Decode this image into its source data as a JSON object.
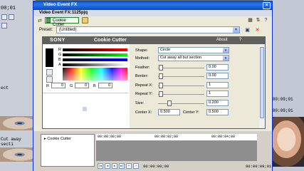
{
  "window": {
    "title": "Video Event FX"
  },
  "header": {
    "label": "Video Event FX:",
    "event_name": "1125pjq"
  },
  "chain": {
    "plugin_label": "Cookie Cutter"
  },
  "preset": {
    "label": "Preset:",
    "value": "(Untitled)"
  },
  "plugin": {
    "brand": "SONY",
    "name": "Cookie Cutter",
    "about": "About",
    "help": "?",
    "color": {
      "labels": [
        "R",
        "G",
        "B",
        "A"
      ],
      "r_label": "R",
      "r_value": "0",
      "g_label": "G",
      "g_value": "0",
      "b_label": "B",
      "b_value": "0"
    },
    "params": {
      "shape_label": "Shape:",
      "shape_value": "Circle",
      "method_label": "Method:",
      "method_value": "Cut away all but section",
      "feather_label": "Feather:",
      "feather_value": "0.00",
      "border_label": "Border:",
      "border_value": "0.00",
      "repeat_x_label": "Repeat X:",
      "repeat_x_value": "1",
      "repeat_y_label": "Repeat Y:",
      "repeat_y_value": "1",
      "size_label": "Size:",
      "size_value": "0.200",
      "center_x_label": "Center X:",
      "center_x_value": "0.500",
      "center_y_label": "Center Y:",
      "center_y_value": "0.500"
    }
  },
  "keyframes": {
    "item": "Cookie Cutter",
    "ruler": [
      "00:00:00;00",
      "00:00:02;00",
      "00:00:04;00"
    ],
    "timecode": "00:00:09;01",
    "timecode_start": "00:00:00;00"
  },
  "background": {
    "left_timecode": "00;01",
    "left_label_1": "ect",
    "left_label_2": "Cut away secti",
    "right_timecode": "00:00:09;01",
    "right_timecode_2": "00:00:09;01"
  },
  "colors": {
    "accent": "#0a5bd8",
    "panel": "#ece9d8",
    "plugin_header": "#5f5f5f"
  },
  "icons": [
    "chain-icon",
    "dropdown-arrow-icon",
    "save-icon",
    "delete-icon",
    "help-icon",
    "close-icon"
  ]
}
